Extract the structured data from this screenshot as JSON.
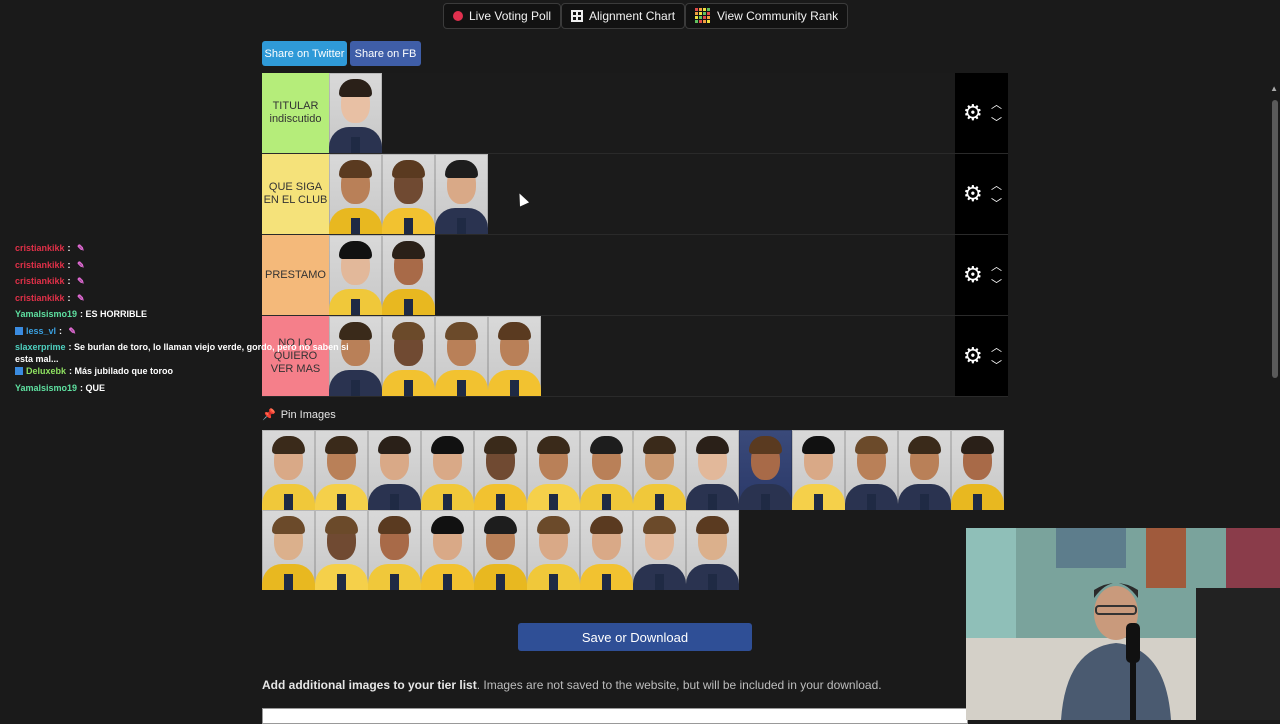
{
  "top_buttons": {
    "live_voting": "Live Voting Poll",
    "alignment": "Alignment Chart",
    "community": "View Community Rank"
  },
  "share": {
    "twitter": "Share on Twitter",
    "fb": "Share on FB",
    "twitter_color": "#2f9ad8",
    "fb_color": "#3f5ea8"
  },
  "tiers": [
    {
      "label": "TITULAR indiscutido",
      "color": "#b5ed7a",
      "count": 1
    },
    {
      "label": "QUE SIGA EN EL CLUB",
      "color": "#f5e27a",
      "count": 3
    },
    {
      "label": "PRESTAMO",
      "color": "#f4b97a",
      "count": 2
    },
    {
      "label": "NO LO QUIERO VER MAS",
      "color": "#f57f8a",
      "count": 4
    }
  ],
  "tier_icons": {
    "settings": "gear-icon",
    "up": "chevron-up-icon",
    "down": "chevron-down-icon"
  },
  "pin_images_label": "Pin Images",
  "pool_count": 23,
  "save_button": "Save or Download",
  "add_images": {
    "bold": "Add additional images to your tier list",
    "text": ". Images are not saved to the website, but will be included in your download."
  },
  "chat": [
    {
      "user": "cristiankikk",
      "color": "#e03048",
      "text": "",
      "emote": true,
      "badge": false
    },
    {
      "user": "cristiankikk",
      "color": "#e03048",
      "text": "",
      "emote": true,
      "badge": false
    },
    {
      "user": "cristiankikk",
      "color": "#e03048",
      "text": "",
      "emote": true,
      "badge": false
    },
    {
      "user": "cristiankikk",
      "color": "#e03048",
      "text": "",
      "emote": true,
      "badge": false
    },
    {
      "user": "Yamalsismo19",
      "color": "#5ee0a0",
      "text": "ES HORRIBLE",
      "emote": false,
      "badge": false
    },
    {
      "user": "less_vl",
      "color": "#3aa0e0",
      "text": "",
      "emote": true,
      "badge": true
    },
    {
      "user": "slaxerprime",
      "color": "#4ed0c0",
      "text": "Se burlan de toro, lo llaman viejo verde, gordo, pero no saben si esta mal...",
      "emote": false,
      "badge": false
    },
    {
      "user": "Deluxebk",
      "color": "#8ee060",
      "text": "Más jubilado que toroo",
      "emote": false,
      "badge": true
    },
    {
      "user": "Yamalsismo19",
      "color": "#5ee0a0",
      "text": "QUE",
      "emote": false,
      "badge": false
    }
  ]
}
